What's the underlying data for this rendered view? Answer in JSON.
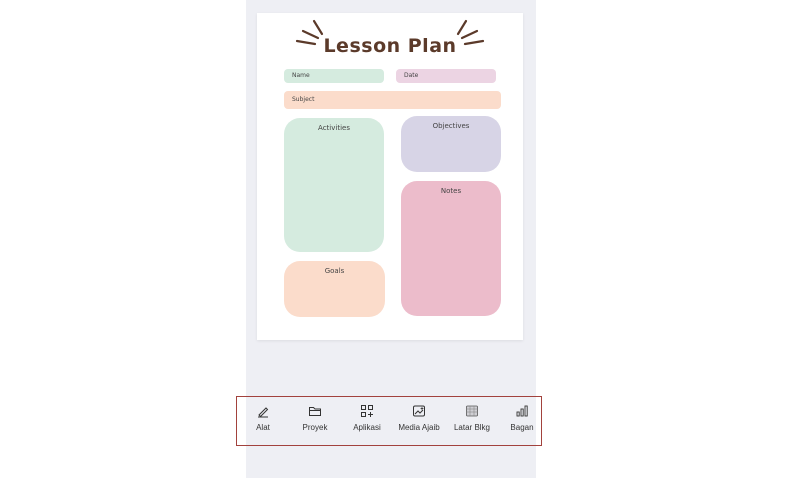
{
  "document": {
    "title": "Lesson Plan",
    "fields": {
      "name_label": "Name",
      "date_label": "Date",
      "subject_label": "Subject"
    },
    "sections": {
      "activities": "Activities",
      "objectives": "Objectives",
      "notes": "Notes",
      "goals": "Goals"
    }
  },
  "colors": {
    "title_brown": "#5b3a2a",
    "green": "#d5ebdf",
    "pink_field": "#ecd4e3",
    "peach": "#fbdccb",
    "lavender": "#d7d4e6",
    "rose": "#ecbccb",
    "highlight_border": "#a2423d"
  },
  "toolbar": {
    "items": [
      {
        "label": "Alat",
        "icon": "pen-icon"
      },
      {
        "label": "Proyek",
        "icon": "folder-icon"
      },
      {
        "label": "Aplikasi",
        "icon": "apps-icon"
      },
      {
        "label": "Media Ajaib",
        "icon": "magic-media-icon"
      },
      {
        "label": "Latar Blkg",
        "icon": "background-icon"
      },
      {
        "label": "Bagan",
        "icon": "chart-icon"
      }
    ]
  }
}
